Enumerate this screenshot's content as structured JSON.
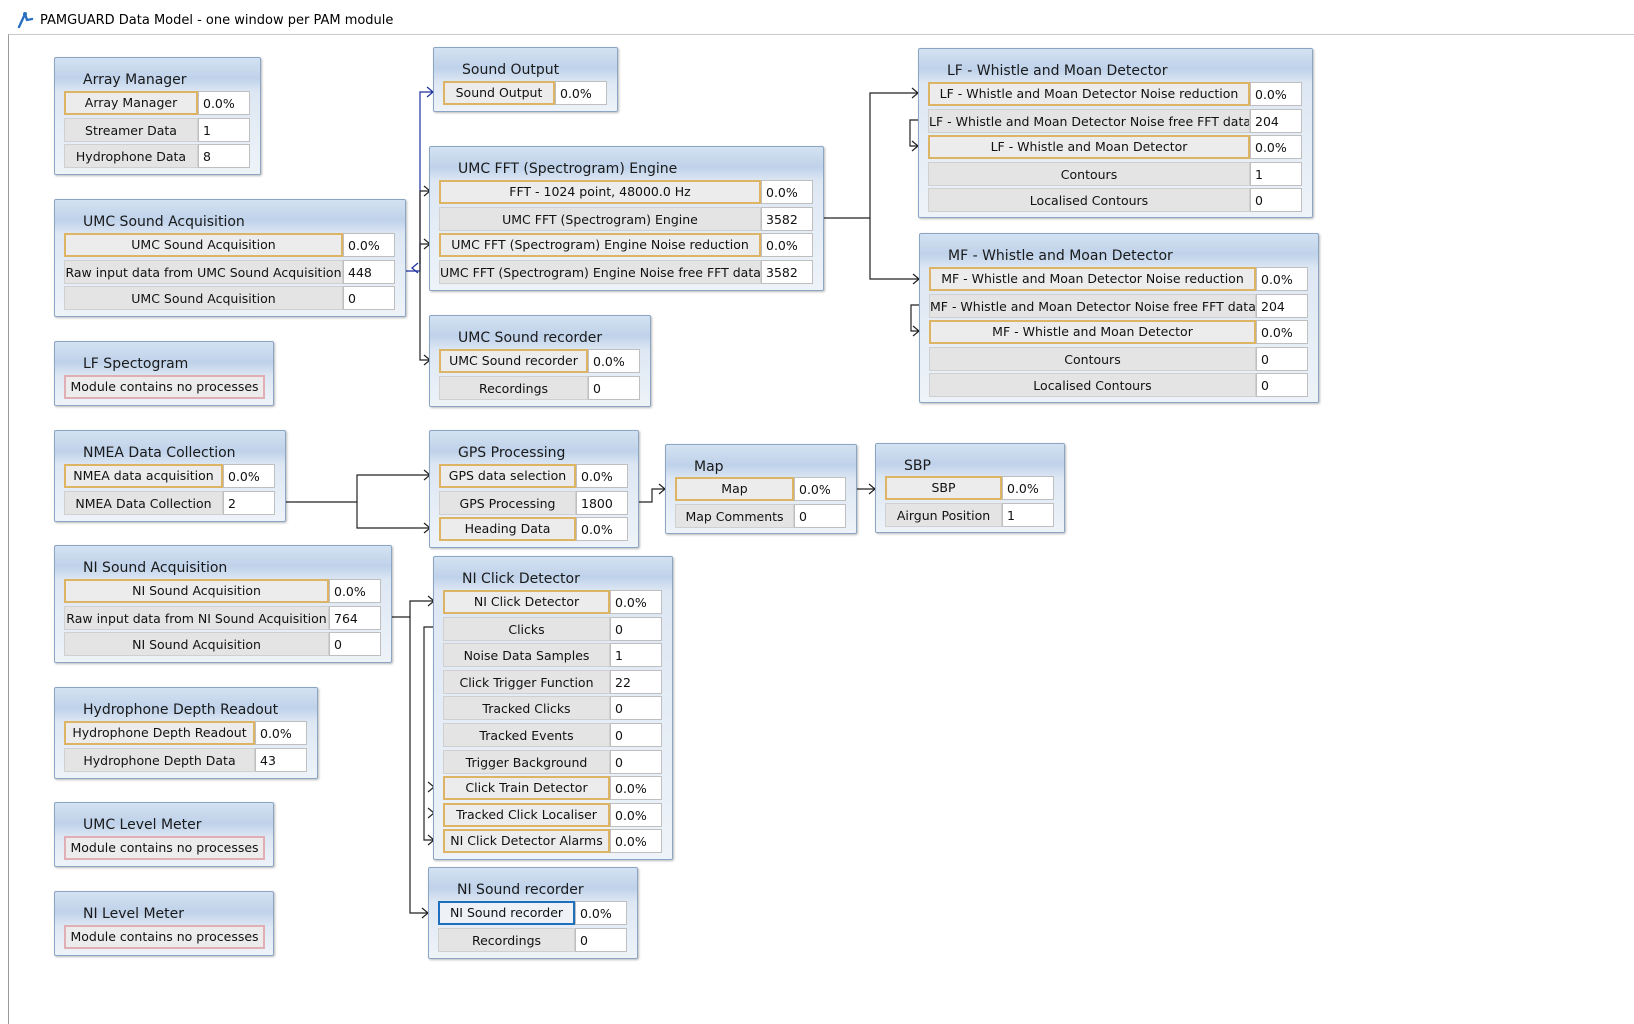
{
  "window": {
    "title": "PAMGUARD Data Model - one window per PAM module",
    "icon": "pamguard-logo-icon"
  },
  "modules": {
    "array_manager": {
      "title": "Array Manager",
      "rows": [
        {
          "label": "Array Manager",
          "value": "0.0%"
        },
        {
          "label": "Streamer Data",
          "value": "1"
        },
        {
          "label": "Hydrophone Data",
          "value": "8"
        }
      ]
    },
    "umc_acq": {
      "title": "UMC Sound Acquisition",
      "rows": [
        {
          "label": "UMC Sound Acquisition",
          "value": "0.0%"
        },
        {
          "label": "Raw input data from UMC Sound Acquisition",
          "value": "448"
        },
        {
          "label": "UMC Sound Acquisition",
          "value": "0"
        }
      ]
    },
    "lf_spec": {
      "title": "LF Spectogram",
      "rows": [
        {
          "label": "Module contains no processes"
        }
      ]
    },
    "nmea": {
      "title": "NMEA Data Collection",
      "rows": [
        {
          "label": "NMEA data acquisition",
          "value": "0.0%"
        },
        {
          "label": "NMEA Data Collection",
          "value": "2"
        }
      ]
    },
    "ni_acq": {
      "title": "NI Sound Acquisition",
      "rows": [
        {
          "label": "NI Sound Acquisition",
          "value": "0.0%"
        },
        {
          "label": "Raw input data from NI Sound Acquisition",
          "value": "764"
        },
        {
          "label": "NI Sound Acquisition",
          "value": "0"
        }
      ]
    },
    "hydro_depth": {
      "title": "Hydrophone Depth Readout",
      "rows": [
        {
          "label": "Hydrophone Depth Readout",
          "value": "0.0%"
        },
        {
          "label": "Hydrophone Depth Data",
          "value": "43"
        }
      ]
    },
    "umc_level": {
      "title": "UMC Level Meter",
      "rows": [
        {
          "label": "Module contains no processes"
        }
      ]
    },
    "ni_level": {
      "title": "NI Level Meter",
      "rows": [
        {
          "label": "Module contains no processes"
        }
      ]
    },
    "sound_output": {
      "title": "Sound Output",
      "rows": [
        {
          "label": "Sound Output",
          "value": "0.0%"
        }
      ]
    },
    "umc_fft": {
      "title": "UMC FFT (Spectrogram) Engine",
      "rows": [
        {
          "label": "FFT - 1024 point, 48000.0 Hz",
          "value": "0.0%"
        },
        {
          "label": "UMC FFT (Spectrogram) Engine",
          "value": "3582"
        },
        {
          "label": "UMC FFT (Spectrogram) Engine Noise reduction",
          "value": "0.0%"
        },
        {
          "label": "UMC FFT (Spectrogram) Engine Noise free FFT data",
          "value": "3582"
        }
      ]
    },
    "umc_recorder": {
      "title": "UMC Sound recorder",
      "rows": [
        {
          "label": "UMC Sound recorder",
          "value": "0.0%"
        },
        {
          "label": "Recordings",
          "value": "0"
        }
      ]
    },
    "gps": {
      "title": "GPS Processing",
      "rows": [
        {
          "label": "GPS data selection",
          "value": "0.0%"
        },
        {
          "label": "GPS Processing",
          "value": "1800"
        },
        {
          "label": "Heading Data",
          "value": "0.0%"
        }
      ]
    },
    "ni_click": {
      "title": "NI Click Detector",
      "rows": [
        {
          "label": "NI Click Detector",
          "value": "0.0%"
        },
        {
          "label": "Clicks",
          "value": "0"
        },
        {
          "label": "Noise Data Samples",
          "value": "1"
        },
        {
          "label": "Click Trigger Function",
          "value": "22"
        },
        {
          "label": "Tracked Clicks",
          "value": "0"
        },
        {
          "label": "Tracked Events",
          "value": "0"
        },
        {
          "label": "Trigger Background",
          "value": "0"
        },
        {
          "label": "Click Train Detector",
          "value": "0.0%"
        },
        {
          "label": "Tracked Click Localiser",
          "value": "0.0%"
        },
        {
          "label": "NI Click Detector Alarms",
          "value": "0.0%"
        }
      ]
    },
    "ni_recorder": {
      "title": "NI Sound recorder",
      "rows": [
        {
          "label": "NI Sound recorder",
          "value": "0.0%"
        },
        {
          "label": "Recordings",
          "value": "0"
        }
      ]
    },
    "map": {
      "title": "Map",
      "rows": [
        {
          "label": "Map",
          "value": "0.0%"
        },
        {
          "label": "Map Comments",
          "value": "0"
        }
      ]
    },
    "sbp": {
      "title": "SBP",
      "rows": [
        {
          "label": "SBP",
          "value": "0.0%"
        },
        {
          "label": "Airgun Position",
          "value": "1"
        }
      ]
    },
    "lf_wmd": {
      "title": "LF - Whistle and Moan Detector",
      "rows": [
        {
          "label": "LF - Whistle and Moan Detector Noise reduction",
          "value": "0.0%"
        },
        {
          "label": "LF - Whistle and Moan Detector Noise free FFT data",
          "value": "204"
        },
        {
          "label": "LF - Whistle and Moan Detector",
          "value": "0.0%"
        },
        {
          "label": "Contours",
          "value": "1"
        },
        {
          "label": "Localised Contours",
          "value": "0"
        }
      ]
    },
    "mf_wmd": {
      "title": "MF - Whistle and Moan Detector",
      "rows": [
        {
          "label": "MF - Whistle and Moan Detector Noise reduction",
          "value": "0.0%"
        },
        {
          "label": "MF - Whistle and Moan Detector Noise free FFT data",
          "value": "204"
        },
        {
          "label": "MF - Whistle and Moan Detector",
          "value": "0.0%"
        },
        {
          "label": "Contours",
          "value": "0"
        },
        {
          "label": "Localised Contours",
          "value": "0"
        }
      ]
    }
  }
}
